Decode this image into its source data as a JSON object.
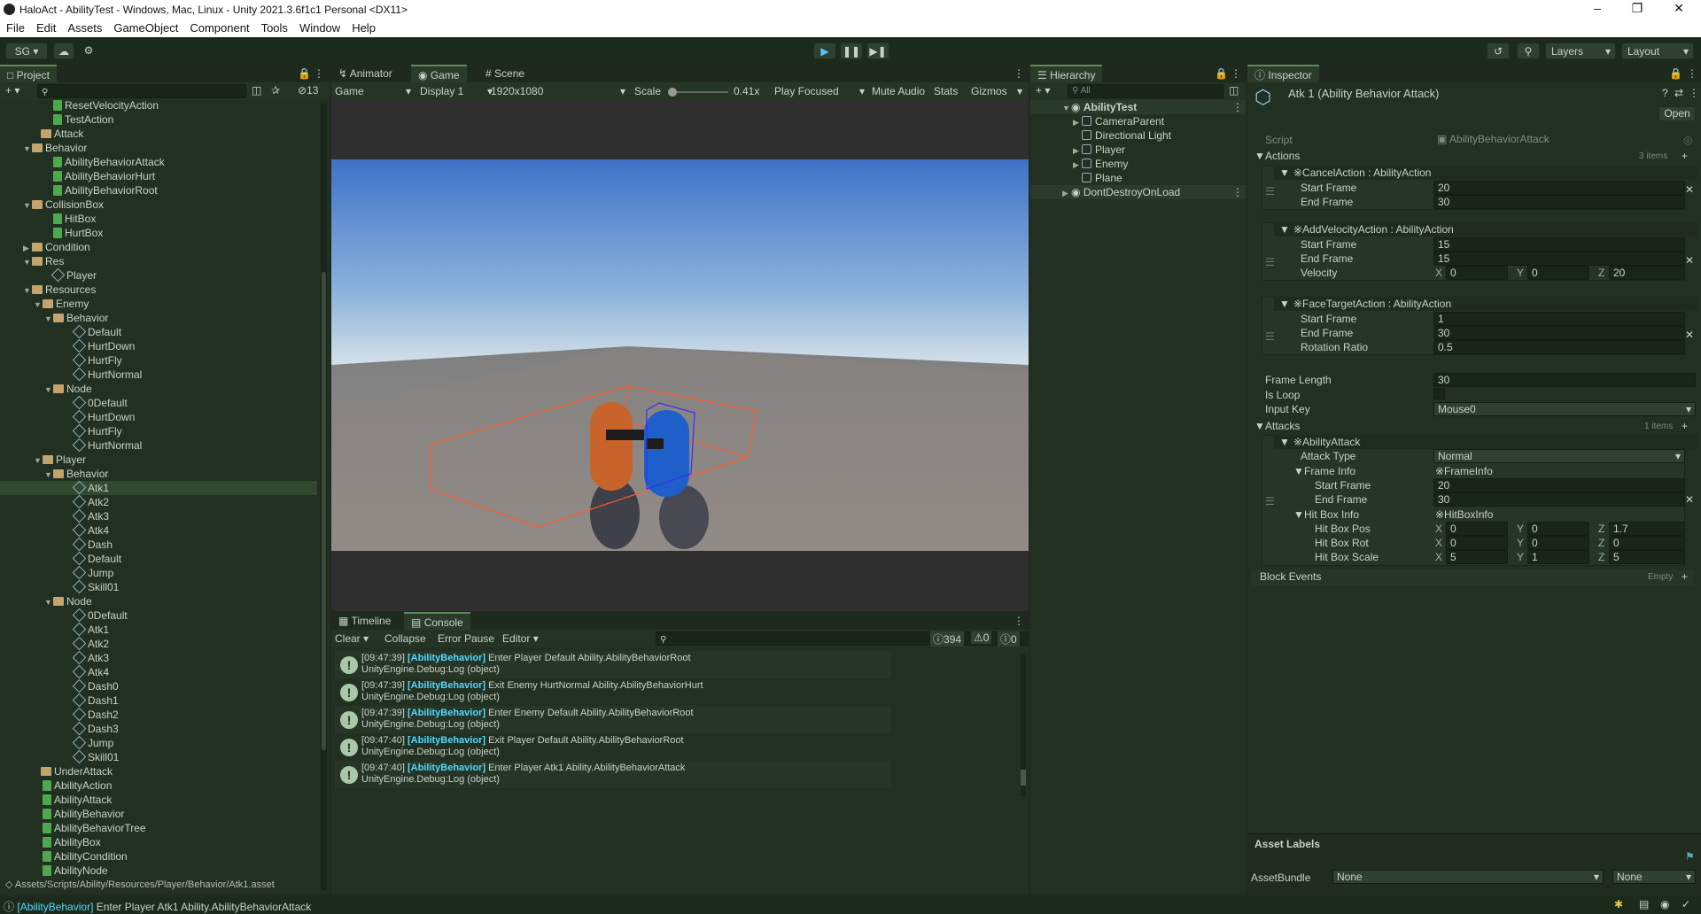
{
  "window": {
    "title": "HaloAct - AbilityTest - Windows, Mac, Linux - Unity 2021.3.6f1c1 Personal <DX11>"
  },
  "menu": [
    "File",
    "Edit",
    "Assets",
    "GameObject",
    "Component",
    "Tools",
    "Window",
    "Help"
  ],
  "toolbar": {
    "account": "SG",
    "layers": "Layers",
    "layout": "Layout"
  },
  "project": {
    "tab": "Project",
    "hidden_count": "13",
    "path": "Assets/Scripts/Ability/Resources/Player/Behavior/Atk1.asset",
    "items": [
      {
        "label": "ResetVelocityAction",
        "type": "cs",
        "indent": 60
      },
      {
        "label": "TestAction",
        "type": "cs",
        "indent": 60
      },
      {
        "label": "Attack",
        "type": "folder",
        "indent": 48
      },
      {
        "label": "Behavior",
        "type": "folder",
        "indent": 38,
        "open": true
      },
      {
        "label": "AbilityBehaviorAttack",
        "type": "cs",
        "indent": 60
      },
      {
        "label": "AbilityBehaviorHurt",
        "type": "cs",
        "indent": 60
      },
      {
        "label": "AbilityBehaviorRoot",
        "type": "cs",
        "indent": 60
      },
      {
        "label": "CollisionBox",
        "type": "folder",
        "indent": 38,
        "open": true
      },
      {
        "label": "HitBox",
        "type": "cs",
        "indent": 60
      },
      {
        "label": "HurtBox",
        "type": "cs",
        "indent": 60
      },
      {
        "label": "Condition",
        "type": "folder",
        "indent": 38,
        "closed": true
      },
      {
        "label": "Res",
        "type": "folder",
        "indent": 38,
        "open": true
      },
      {
        "label": "Player",
        "type": "prefab",
        "indent": 60
      },
      {
        "label": "Resources",
        "type": "folder",
        "indent": 38,
        "open": true
      },
      {
        "label": "Enemy",
        "type": "folder",
        "indent": 50,
        "open": true
      },
      {
        "label": "Behavior",
        "type": "folder",
        "indent": 62,
        "open": true
      },
      {
        "label": "Default",
        "type": "prefab",
        "indent": 84
      },
      {
        "label": "HurtDown",
        "type": "prefab",
        "indent": 84
      },
      {
        "label": "HurtFly",
        "type": "prefab",
        "indent": 84
      },
      {
        "label": "HurtNormal",
        "type": "prefab",
        "indent": 84
      },
      {
        "label": "Node",
        "type": "folder",
        "indent": 62,
        "open": true
      },
      {
        "label": "0Default",
        "type": "prefab",
        "indent": 84
      },
      {
        "label": "HurtDown",
        "type": "prefab",
        "indent": 84
      },
      {
        "label": "HurtFly",
        "type": "prefab",
        "indent": 84
      },
      {
        "label": "HurtNormal",
        "type": "prefab",
        "indent": 84
      },
      {
        "label": "Player",
        "type": "folder",
        "indent": 50,
        "open": true
      },
      {
        "label": "Behavior",
        "type": "folder",
        "indent": 62,
        "open": true
      },
      {
        "label": "Atk1",
        "type": "prefab",
        "indent": 84,
        "selected": true
      },
      {
        "label": "Atk2",
        "type": "prefab",
        "indent": 84
      },
      {
        "label": "Atk3",
        "type": "prefab",
        "indent": 84
      },
      {
        "label": "Atk4",
        "type": "prefab",
        "indent": 84
      },
      {
        "label": "Dash",
        "type": "prefab",
        "indent": 84
      },
      {
        "label": "Default",
        "type": "prefab",
        "indent": 84
      },
      {
        "label": "Jump",
        "type": "prefab",
        "indent": 84
      },
      {
        "label": "Skill01",
        "type": "prefab",
        "indent": 84
      },
      {
        "label": "Node",
        "type": "folder",
        "indent": 62,
        "open": true
      },
      {
        "label": "0Default",
        "type": "prefab",
        "indent": 84
      },
      {
        "label": "Atk1",
        "type": "prefab",
        "indent": 84
      },
      {
        "label": "Atk2",
        "type": "prefab",
        "indent": 84
      },
      {
        "label": "Atk3",
        "type": "prefab",
        "indent": 84
      },
      {
        "label": "Atk4",
        "type": "prefab",
        "indent": 84
      },
      {
        "label": "Dash0",
        "type": "prefab",
        "indent": 84
      },
      {
        "label": "Dash1",
        "type": "prefab",
        "indent": 84
      },
      {
        "label": "Dash2",
        "type": "prefab",
        "indent": 84
      },
      {
        "label": "Dash3",
        "type": "prefab",
        "indent": 84
      },
      {
        "label": "Jump",
        "type": "prefab",
        "indent": 84
      },
      {
        "label": "Skill01",
        "type": "prefab",
        "indent": 84
      },
      {
        "label": "UnderAttack",
        "type": "folder",
        "indent": 48
      },
      {
        "label": "AbilityAction",
        "type": "cs",
        "indent": 48
      },
      {
        "label": "AbilityAttack",
        "type": "cs",
        "indent": 48
      },
      {
        "label": "AbilityBehavior",
        "type": "cs",
        "indent": 48
      },
      {
        "label": "AbilityBehaviorTree",
        "type": "cs",
        "indent": 48
      },
      {
        "label": "AbilityBox",
        "type": "cs",
        "indent": 48
      },
      {
        "label": "AbilityCondition",
        "type": "cs",
        "indent": 48
      },
      {
        "label": "AbilityNode",
        "type": "cs",
        "indent": 48
      }
    ]
  },
  "game": {
    "tabs": [
      "Animator",
      "Game",
      "Scene"
    ],
    "mode": "Game",
    "display": "Display 1",
    "resolution": "1920x1080",
    "scale_label": "Scale",
    "scale_value": "0.41x",
    "play_focused": "Play Focused",
    "mute": "Mute Audio",
    "stats": "Stats",
    "gizmos": "Gizmos"
  },
  "console": {
    "tabs": [
      "Timeline",
      "Console"
    ],
    "clear": "Clear",
    "collapse": "Collapse",
    "error_pause": "Error Pause",
    "editor": "Editor",
    "count_log": "394",
    "count_warn": "0",
    "count_err": "0",
    "entries": [
      {
        "time": "[09:47:39]",
        "tag": "[AbilityBehavior]",
        "msg": "Enter Player Default Ability.AbilityBehaviorRoot",
        "trace": "UnityEngine.Debug:Log (object)"
      },
      {
        "time": "[09:47:39]",
        "tag": "[AbilityBehavior]",
        "msg": "Exit Enemy HurtNormal Ability.AbilityBehaviorHurt",
        "trace": "UnityEngine.Debug:Log (object)"
      },
      {
        "time": "[09:47:39]",
        "tag": "[AbilityBehavior]",
        "msg": "Enter Enemy Default Ability.AbilityBehaviorRoot",
        "trace": "UnityEngine.Debug:Log (object)"
      },
      {
        "time": "[09:47:40]",
        "tag": "[AbilityBehavior]",
        "msg": "Exit Player Default Ability.AbilityBehaviorRoot",
        "trace": "UnityEngine.Debug:Log (object)"
      },
      {
        "time": "[09:47:40]",
        "tag": "[AbilityBehavior]",
        "msg": "Enter Player Atk1 Ability.AbilityBehaviorAttack",
        "trace": "UnityEngine.Debug:Log (object)"
      }
    ]
  },
  "hierarchy": {
    "tab": "Hierarchy",
    "search_placeholder": "All",
    "scene": "AbilityTest",
    "items": [
      "CameraParent",
      "Directional Light",
      "Player",
      "Enemy",
      "Plane"
    ],
    "ddol": "DontDestroyOnLoad"
  },
  "inspector": {
    "tab": "Inspector",
    "title": "Atk 1 (Ability Behavior Attack)",
    "open": "Open",
    "script_label": "Script",
    "script_value": "AbilityBehaviorAttack",
    "actions_label": "Actions",
    "actions_count": "3 items",
    "action1": {
      "header": "※CancelAction : AbilityAction",
      "start_label": "Start Frame",
      "start": "20",
      "end_label": "End Frame",
      "end": "30"
    },
    "action2": {
      "header": "※AddVelocityAction : AbilityAction",
      "start_label": "Start Frame",
      "start": "15",
      "end_label": "End Frame",
      "end": "15",
      "vel_label": "Velocity",
      "vx": "0",
      "vy": "0",
      "vz": "20"
    },
    "action3": {
      "header": "※FaceTargetAction : AbilityAction",
      "start_label": "Start Frame",
      "start": "1",
      "end_label": "End Frame",
      "end": "30",
      "rot_label": "Rotation Ratio",
      "rot": "0.5"
    },
    "frame_length_label": "Frame Length",
    "frame_length": "30",
    "is_loop_label": "Is Loop",
    "input_key_label": "Input Key",
    "input_key": "Mouse0",
    "attacks_label": "Attacks",
    "attacks_count": "1 items",
    "attack_header": "※AbilityAttack",
    "attack_type_label": "Attack Type",
    "attack_type": "Normal",
    "frame_info_label": "Frame Info",
    "frame_info": "※FrameInfo",
    "fi_start_label": "Start Frame",
    "fi_start": "20",
    "fi_end_label": "End Frame",
    "fi_end": "30",
    "hitbox_info_label": "Hit Box Info",
    "hitbox_info": "※HitBoxInfo",
    "pos_label": "Hit Box Pos",
    "pos": [
      "0",
      "0",
      "1.7"
    ],
    "rot_label": "Hit Box Rot",
    "rot": [
      "0",
      "0",
      "0"
    ],
    "scale_label": "Hit Box Scale",
    "scale": [
      "5",
      "1",
      "5"
    ],
    "block_events_label": "Block Events",
    "block_events_value": "Empty",
    "asset_labels": "Asset Labels",
    "asset_bundle_label": "AssetBundle",
    "asset_bundle": "None",
    "asset_variant": "None"
  },
  "statusbar": {
    "tag": "[AbilityBehavior]",
    "msg": "Enter Player Atk1 Ability.AbilityBehaviorAttack"
  },
  "axes": [
    "X",
    "Y",
    "Z"
  ]
}
